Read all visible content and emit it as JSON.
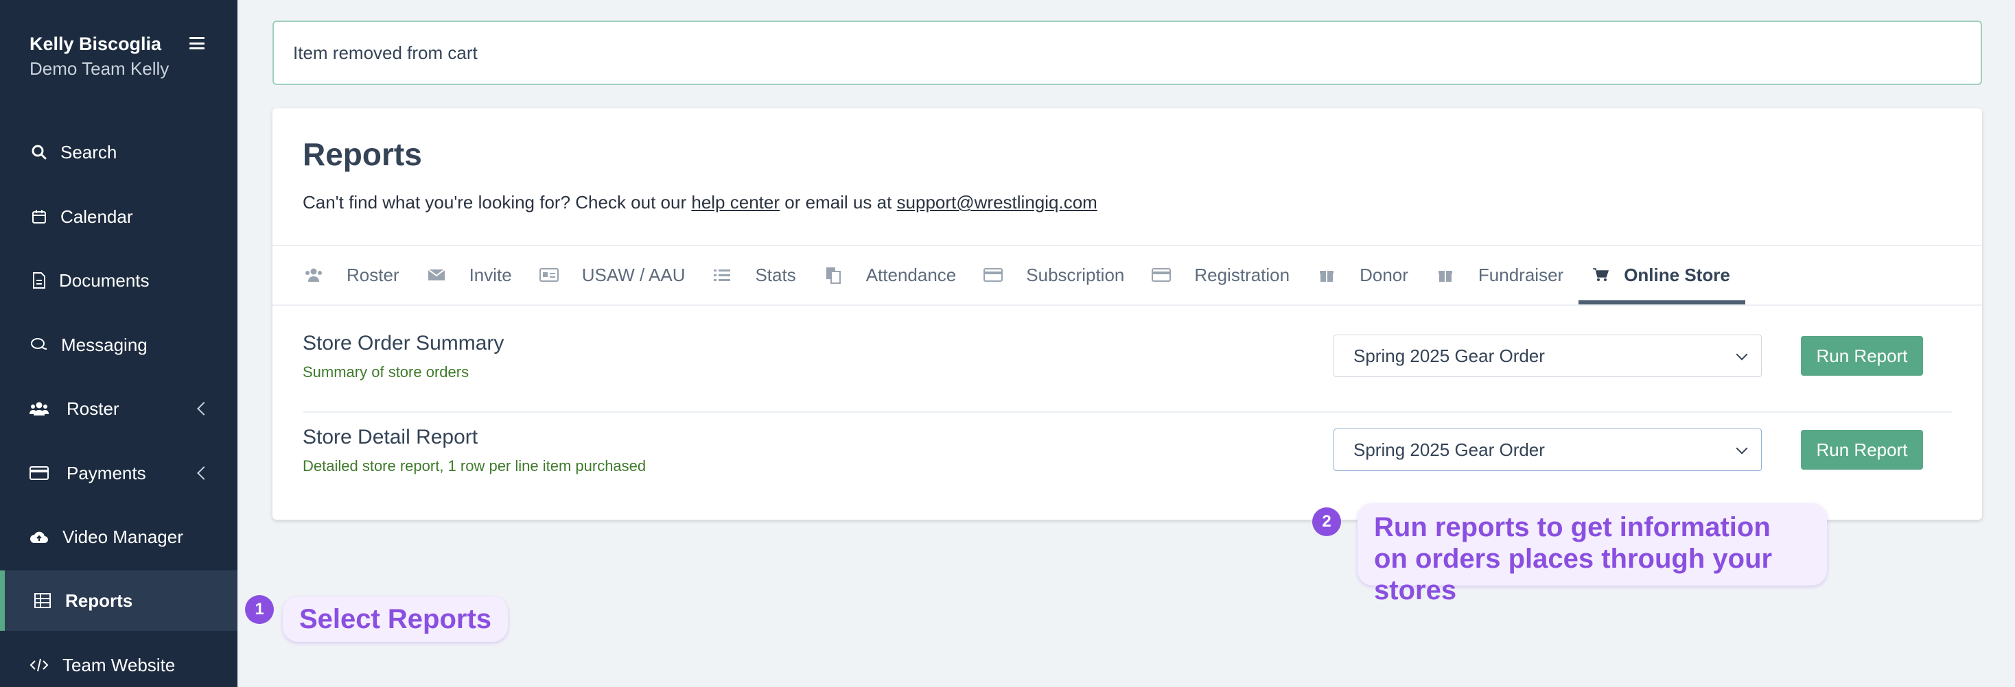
{
  "user": {
    "name": "Kelly Biscoglia",
    "team": "Demo Team Kelly"
  },
  "sidebar": {
    "items": [
      {
        "label": "Search",
        "icon": "search-icon"
      },
      {
        "label": "Calendar",
        "icon": "calendar-icon"
      },
      {
        "label": "Documents",
        "icon": "document-icon"
      },
      {
        "label": "Messaging",
        "icon": "chat-icon"
      },
      {
        "label": "Roster",
        "icon": "users-icon",
        "expandable": true
      },
      {
        "label": "Payments",
        "icon": "credit-card-icon",
        "expandable": true
      },
      {
        "label": "Video Manager",
        "icon": "cloud-upload-icon"
      },
      {
        "label": "Reports",
        "icon": "table-icon",
        "active": true
      },
      {
        "label": "Team Website",
        "icon": "code-icon"
      }
    ]
  },
  "toast": {
    "message": "Item removed from cart"
  },
  "reports": {
    "title": "Reports",
    "help_prefix": "Can't find what you're looking for? Check out our ",
    "help_link": "help center",
    "help_middle": " or email us at ",
    "email": "support@wrestlingiq.com",
    "tabs": [
      {
        "label": "Roster",
        "icon": "users-icon"
      },
      {
        "label": "Invite",
        "icon": "envelope-icon"
      },
      {
        "label": "USAW / AAU",
        "icon": "id-card-icon"
      },
      {
        "label": "Stats",
        "icon": "list-icon"
      },
      {
        "label": "Attendance",
        "icon": "copy-icon"
      },
      {
        "label": "Subscription",
        "icon": "credit-card-icon"
      },
      {
        "label": "Registration",
        "icon": "credit-card-icon"
      },
      {
        "label": "Donor",
        "icon": "gift-icon"
      },
      {
        "label": "Fundraiser",
        "icon": "gift-icon"
      },
      {
        "label": "Online Store",
        "icon": "cart-icon",
        "active": true
      }
    ],
    "rows": [
      {
        "title": "Store Order Summary",
        "description": "Summary of store orders",
        "selected": "Spring 2025 Gear Order",
        "button": "Run Report"
      },
      {
        "title": "Store Detail Report",
        "description": "Detailed store report, 1 row per line item purchased",
        "selected": "Spring 2025 Gear Order",
        "button": "Run Report"
      }
    ]
  },
  "callouts": [
    {
      "number": "1",
      "text": "Select Reports"
    },
    {
      "number": "2",
      "text": "Run reports to get information on orders places through your stores"
    }
  ],
  "colors": {
    "sidebar": "#1c2b3f",
    "accent": "#57a886",
    "callout": "#8a4fe0"
  }
}
